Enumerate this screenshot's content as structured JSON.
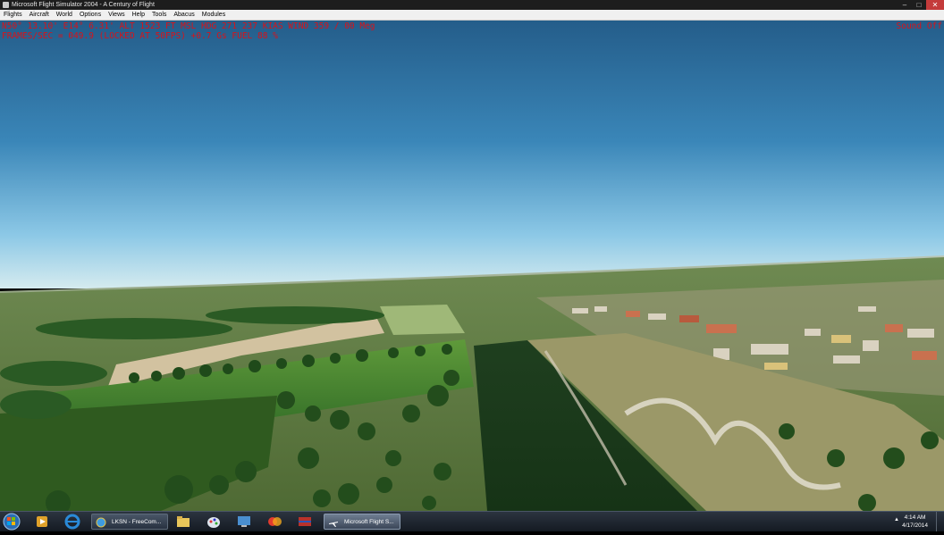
{
  "window": {
    "title": "Microsoft Flight Simulator 2004 - A Century of Flight"
  },
  "menu": {
    "items": [
      "Flights",
      "Aircraft",
      "World",
      "Options",
      "Views",
      "Help",
      "Tools",
      "Abacus",
      "Modules"
    ]
  },
  "hud": {
    "line1": "N50° 13.10'  E14° 6.31'  ALT  1523 FT  MSL  HDG 271   237 KIAS  WIND 359 / 00 Meg",
    "line2": "FRAMES/SEC = 049.9 (LOCKED AT 50FPS)    +0.7 Gs   FUEL  88 %",
    "sound": "Sound Off",
    "color": "#d8131a"
  },
  "taskbar": {
    "tasks": [
      {
        "label": "LKSN - FreeCom...",
        "icon": "globe-icon"
      },
      {
        "label": "Microsoft Flight S...",
        "icon": "airplane-icon",
        "active": true
      }
    ],
    "clock": {
      "time": "4:14 AM",
      "date": "4/17/2014"
    }
  }
}
